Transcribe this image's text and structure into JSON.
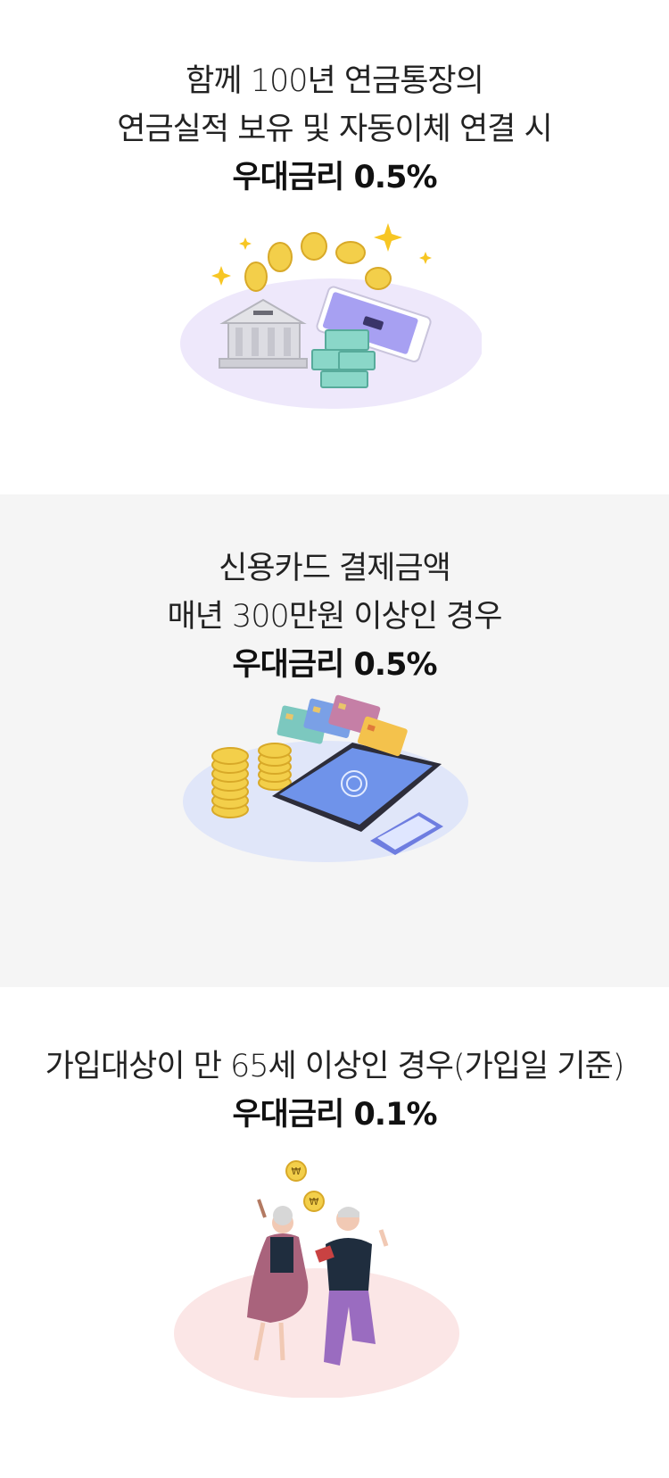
{
  "sections": [
    {
      "id": "pension-account",
      "lines": [
        "함께 100년 연금통장의",
        "연금실적 보유 및 자동이체 연결 시"
      ],
      "rate": "우대금리 0.5%",
      "illustration": "bank-coins-phone-illustration"
    },
    {
      "id": "credit-card",
      "lines": [
        "신용카드 결제금액",
        "매년 300만원 이상인 경우"
      ],
      "rate": "우대금리 0.5%",
      "illustration": "credit-cards-tablet-illustration"
    },
    {
      "id": "senior",
      "lines": [
        "가입대상이 만 65세 이상인 경우(가입일 기준)"
      ],
      "rate": "우대금리 0.1%",
      "illustration": "senior-couple-celebrating-illustration"
    }
  ],
  "colors": {
    "alt_section_bg": "#f5f5f5",
    "coin_gold": "#f3cf4a",
    "lavender": "#eee8fb",
    "light_blue": "#e0e6f9",
    "pink": "#fbe6e6"
  }
}
